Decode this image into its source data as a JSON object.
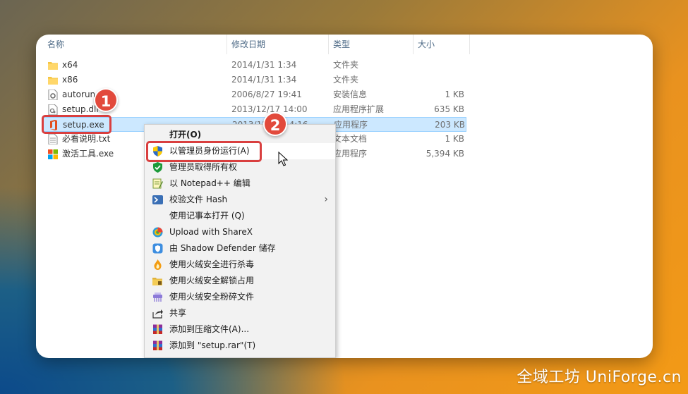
{
  "columns": {
    "name": "名称",
    "date": "修改日期",
    "type": "类型",
    "size": "大小"
  },
  "files": [
    {
      "name": "x64",
      "date": "2014/1/31 1:34",
      "type": "文件夹",
      "size": "",
      "icon": "folder-icon"
    },
    {
      "name": "x86",
      "date": "2014/1/31 1:34",
      "type": "文件夹",
      "size": "",
      "icon": "folder-icon"
    },
    {
      "name": "autorun",
      "date": "2006/8/27 19:41",
      "type": "安装信息",
      "size": "1 KB",
      "icon": "settings-file-icon"
    },
    {
      "name": "setup.dll",
      "date": "2013/12/17 14:00",
      "type": "应用程序扩展",
      "size": "635 KB",
      "icon": "dll-file-icon"
    },
    {
      "name": "setup.exe",
      "date": "2013/12/17 14:16",
      "type": "应用程序",
      "size": "203 KB",
      "icon": "office-icon"
    },
    {
      "name": "必看说明.txt",
      "date": "",
      "type": "文本文档",
      "size": "1 KB",
      "icon": "text-file-icon"
    },
    {
      "name": "激活工具.exe",
      "date": "",
      "type": "应用程序",
      "size": "5,394 KB",
      "icon": "app-icon"
    }
  ],
  "badges": {
    "one": "1",
    "two": "2"
  },
  "menu": [
    {
      "label": "打开(O)",
      "icon": ""
    },
    {
      "label": "以管理员身份运行(A)",
      "icon": "uac-shield-icon"
    },
    {
      "label": "管理员取得所有权",
      "icon": "green-shield-icon"
    },
    {
      "label": "以 Notepad++ 编辑",
      "icon": "notepad-icon"
    },
    {
      "label": "校验文件 Hash",
      "icon": "powershell-icon"
    },
    {
      "label": "使用记事本打开 (Q)",
      "icon": ""
    },
    {
      "label": "Upload with ShareX",
      "icon": "sharex-icon"
    },
    {
      "label": "由 Shadow Defender 储存",
      "icon": "shadow-defender-icon"
    },
    {
      "label": "使用火绒安全进行杀毒",
      "icon": "huorong-icon"
    },
    {
      "label": "使用火绒安全解锁占用",
      "icon": "folder-lock-icon"
    },
    {
      "label": "使用火绒安全粉碎文件",
      "icon": "shredder-icon"
    },
    {
      "label": "共享",
      "icon": "share-icon"
    },
    {
      "label": "添加到压缩文件(A)...",
      "icon": "winrar-icon"
    },
    {
      "label": "添加到 \"setup.rar\"(T)",
      "icon": "winrar-icon"
    }
  ],
  "watermark": "全域工坊 UniForge.cn",
  "colors": {
    "callout": "#d93f3f",
    "selection": "#cce8ff",
    "badge": "#e24a3c"
  }
}
